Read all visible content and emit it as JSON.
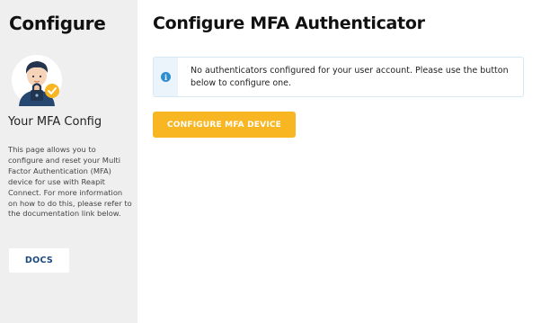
{
  "sidebar": {
    "title": "Configure",
    "subtitle": "Your MFA Config",
    "description": "This page allows you to configure and reset your Multi Factor Authentication (MFA) device for use with Reapit Connect. For more information on how to do this, please refer to the documentation link below.",
    "docs_label": "DOCS",
    "avatar_icon": "user-lock-avatar-icon"
  },
  "main": {
    "title": "Configure MFA Authenticator",
    "info_message": "No authenticators configured for your user account. Please use the button below to configure one.",
    "info_icon": "info-icon",
    "configure_label": "CONFIGURE MFA DEVICE"
  },
  "colors": {
    "sidebar_bg": "#efefef",
    "accent": "#f9b623",
    "info": "#2f8ed0",
    "docs_text": "#1c4a7f"
  }
}
